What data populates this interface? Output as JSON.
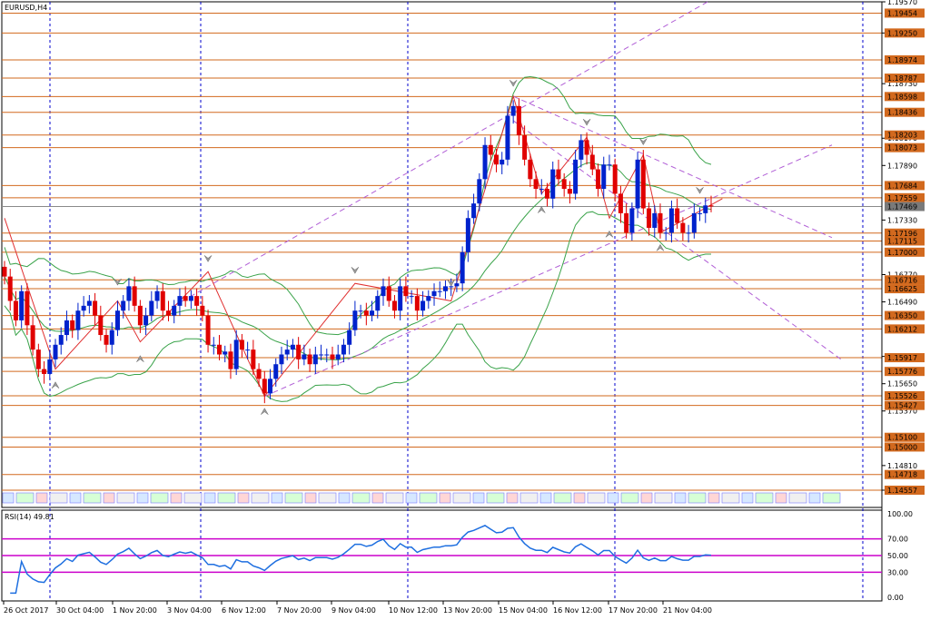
{
  "title": "EURUSD,H4",
  "rsi_label": "RSI(14) 49.81",
  "colors": {
    "bull": "#0022cc",
    "bear": "#e00000",
    "level_line": "#d2691e",
    "price_label_bg": "#d2691e",
    "band": "#3aa34a",
    "channel": "#b15fd6",
    "rsi_line": "#1e6fe0",
    "rsi_level": "#cc00cc",
    "axis": "#0000ff",
    "grid": "#0000cc"
  },
  "chart_data": [
    {
      "type": "candlestick",
      "symbol": "EURUSD",
      "timeframe": "H4",
      "ylim": [
        1.14557,
        1.1957
      ],
      "y_ticks": [
        "1.19570",
        "1.19250",
        "1.18730",
        "1.18170",
        "1.17890",
        "1.17330",
        "1.16770",
        "1.16490",
        "1.15930",
        "1.15650",
        "1.15370",
        "1.14810",
        "1.14557"
      ],
      "levels": [
        "1.19454",
        "1.19250",
        "1.18974",
        "1.18787",
        "1.18598",
        "1.18436",
        "1.18203",
        "1.18073",
        "1.17684",
        "1.17559",
        "1.17469",
        "1.17196",
        "1.17115",
        "1.17000",
        "1.16716",
        "1.16625",
        "1.16350",
        "1.16212",
        "1.15917",
        "1.15776",
        "1.15526",
        "1.15427",
        "1.15100",
        "1.15000",
        "1.14718",
        "1.14557"
      ],
      "current_price": "1.17469",
      "x_labels": [
        "26 Oct 2017",
        "30 Oct 04:00",
        "1 Nov 20:00",
        "3 Nov 04:00",
        "6 Nov 12:00",
        "7 Nov 20:00",
        "9 Nov 04:00",
        "10 Nov 12:00",
        "13 Nov 20:00",
        "15 Nov 04:00",
        "16 Nov 12:00",
        "17 Nov 20:00",
        "21 Nov 04:00"
      ],
      "closes": [
        1.1675,
        1.165,
        1.163,
        1.166,
        1.1625,
        1.16,
        1.158,
        1.1575,
        1.159,
        1.1605,
        1.1615,
        1.163,
        1.162,
        1.164,
        1.1645,
        1.165,
        1.1635,
        1.1615,
        1.1605,
        1.162,
        1.164,
        1.165,
        1.1665,
        1.1645,
        1.1625,
        1.1635,
        1.165,
        1.166,
        1.164,
        1.1635,
        1.1645,
        1.1655,
        1.165,
        1.1655,
        1.1645,
        1.1635,
        1.1605,
        1.1605,
        1.1595,
        1.1598,
        1.158,
        1.161,
        1.16,
        1.16,
        1.158,
        1.157,
        1.1555,
        1.157,
        1.1585,
        1.1595,
        1.16,
        1.1605,
        1.159,
        1.1595,
        1.1585,
        1.1595,
        1.1595,
        1.1595,
        1.159,
        1.1595,
        1.1605,
        1.162,
        1.164,
        1.164,
        1.1635,
        1.164,
        1.1655,
        1.1665,
        1.165,
        1.164,
        1.1665,
        1.1655,
        1.1655,
        1.164,
        1.165,
        1.1655,
        1.166,
        1.166,
        1.1665,
        1.1665,
        1.1668,
        1.17,
        1.1735,
        1.175,
        1.1775,
        1.181,
        1.18,
        1.179,
        1.1795,
        1.184,
        1.185,
        1.182,
        1.1795,
        1.1775,
        1.1765,
        1.1765,
        1.1755,
        1.1785,
        1.1775,
        1.1765,
        1.176,
        1.1795,
        1.1815,
        1.18,
        1.1785,
        1.1765,
        1.179,
        1.179,
        1.176,
        1.174,
        1.172,
        1.1745,
        1.1795,
        1.1745,
        1.1725,
        1.174,
        1.172,
        1.172,
        1.1745,
        1.173,
        1.172,
        1.172,
        1.174,
        1.174,
        1.1748,
        1.1747
      ]
    },
    {
      "type": "line",
      "indicator": "RSI(14)",
      "value": "49.81",
      "ylim": [
        0,
        100
      ],
      "y_ticks": [
        "100.00",
        "70.00",
        "50.00",
        "30.00",
        "0.00"
      ],
      "levels": [
        70,
        50,
        30
      ]
    }
  ]
}
